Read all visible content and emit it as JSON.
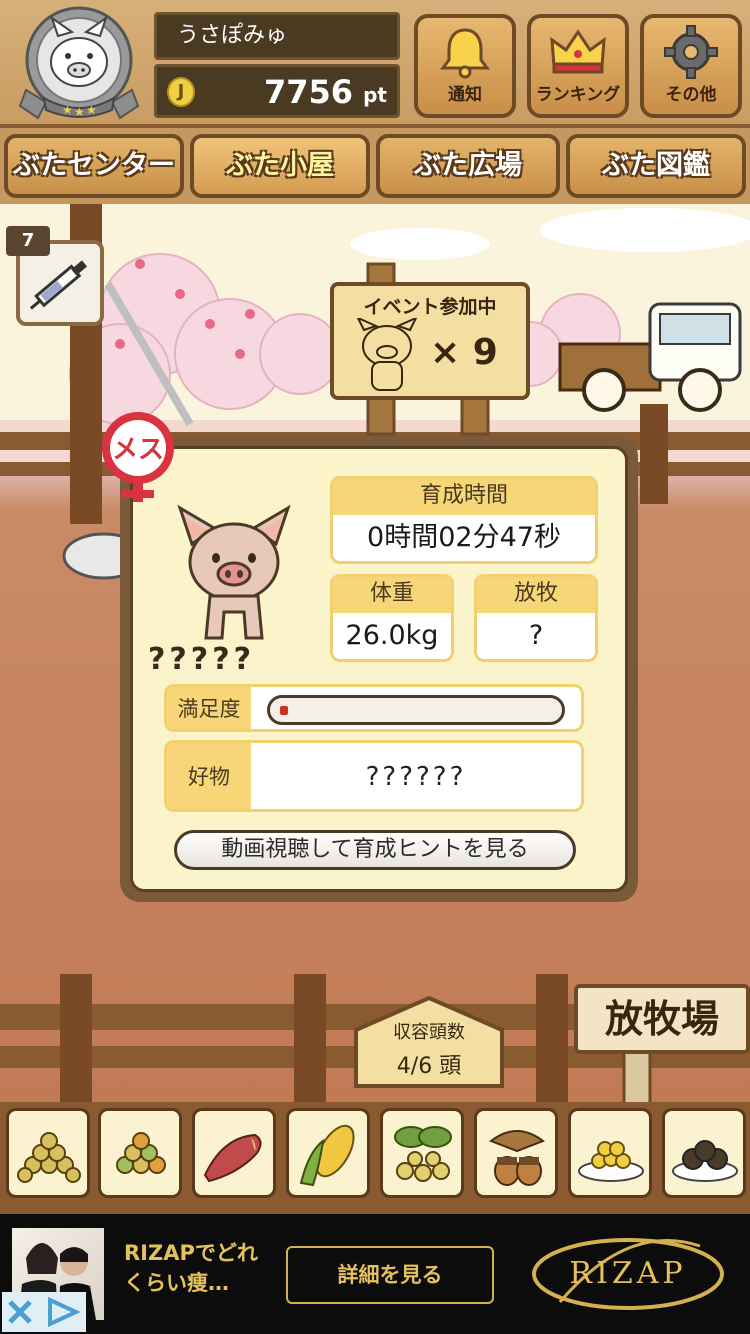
{
  "header": {
    "user_name": "うさぽみゅ",
    "points_value": "7756",
    "points_unit": "pt",
    "rank_stars": 3,
    "buttons": {
      "notify_label": "通知",
      "ranking_label": "ランキング",
      "other_label": "その他"
    }
  },
  "tabs": [
    {
      "label": "ぶたセンター",
      "active": false
    },
    {
      "label": "ぶた小屋",
      "active": true
    },
    {
      "label": "ぶた広場",
      "active": false
    },
    {
      "label": "ぶた図鑑",
      "active": false
    }
  ],
  "scene": {
    "vaccine_count": "7",
    "event_sign_title": "イベント参加中",
    "event_multiplier": "× 9",
    "capacity_label": "収容頭数",
    "capacity_value": "4/6 頭",
    "field_sign": "放牧場"
  },
  "pig": {
    "gender_label": "メス",
    "name": "?????",
    "stats": {
      "growth_time_label": "育成時間",
      "growth_time_value": "0時間02分47秒",
      "weight_label": "体重",
      "weight_value": "26.0kg",
      "grazing_label": "放牧",
      "grazing_value": "?",
      "satisfaction_label": "満足度",
      "satisfaction_fraction": 0.03,
      "favorite_label": "好物",
      "favorite_value": "??????"
    },
    "hint_button": "動画視聴して育成ヒントを見る"
  },
  "food_items": [
    {
      "icon": "feed-pellets-icon"
    },
    {
      "icon": "mixed-feed-icon"
    },
    {
      "icon": "sweet-potato-icon"
    },
    {
      "icon": "corn-icon"
    },
    {
      "icon": "beans-leaves-icon"
    },
    {
      "icon": "acorn-icon"
    },
    {
      "icon": "grain-plate-icon"
    },
    {
      "icon": "truffle-plate-icon"
    }
  ],
  "ad": {
    "text": "RIZAPでどれくらい痩…",
    "button": "詳細を見る",
    "logo": "RIZAP"
  },
  "colors": {
    "panel_border": "#7a5a3a",
    "card_header": "#f7d677",
    "female_red": "#d8333f",
    "ad_gold": "#e4c15c"
  }
}
